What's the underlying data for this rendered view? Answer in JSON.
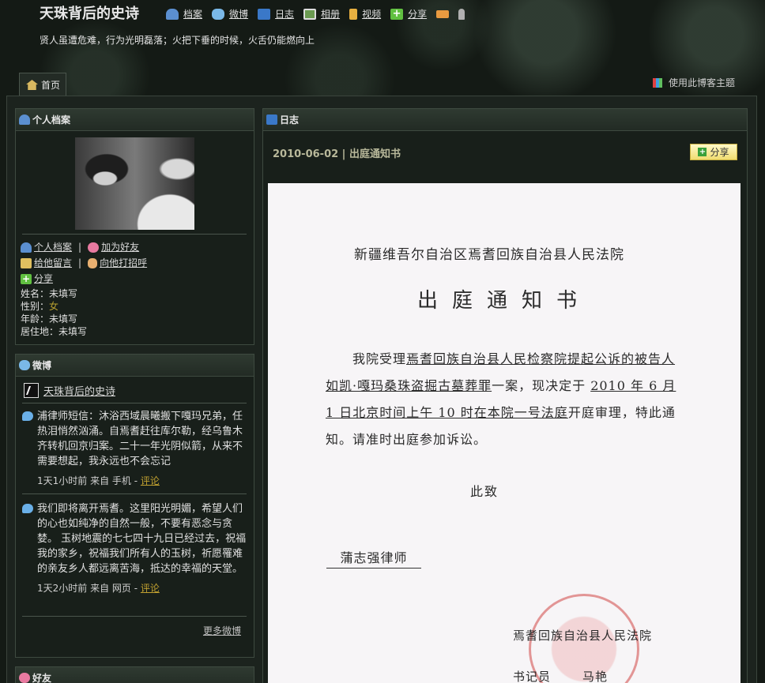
{
  "header": {
    "blog_title": "天珠背后的史诗",
    "subtitle": "贤人虽遭危难，行为光明磊落；火把下垂的时候，火舌仍能燃向上",
    "nav": [
      {
        "label": "档案",
        "icon": "user-icon",
        "color": "#5b8fd0"
      },
      {
        "label": "微博",
        "icon": "speech-bubbles-icon",
        "color": "#7ab8e8"
      },
      {
        "label": "日志",
        "icon": "book-icon",
        "color": "#3a78c8"
      },
      {
        "label": "相册",
        "icon": "photo-icon",
        "color": "#6a9a50"
      },
      {
        "label": "视频",
        "icon": "film-icon",
        "color": "#e8b040"
      },
      {
        "label": "分享",
        "icon": "plus-icon",
        "color": "#60c040"
      }
    ],
    "extra_icons": [
      "mail-icon",
      "person-icon"
    ],
    "home_tab": "首页",
    "theme_link": "使用此博客主题"
  },
  "profile": {
    "title": "个人档案",
    "links": {
      "profile": "个人档案",
      "add_friend": "加为好友",
      "message": "给他留言",
      "greet": "向他打招呼",
      "share": "分享"
    },
    "info": {
      "name_label": "姓名：",
      "name": "未填写",
      "gender_label": "性别：",
      "gender": "女",
      "age_label": "年龄：",
      "age": "未填写",
      "location_label": "居住地：",
      "location": "未填写"
    }
  },
  "weibo": {
    "title": "微博",
    "user": "天珠背后的史诗",
    "posts": [
      {
        "text": "浦律师短信：沐浴西域晨曦搬下嘎玛兄弟，任热泪悄然汹涌。自焉耆赶往库尔勒，经乌鲁木齐转机回京归案。二十一年光阴似箭，从来不需要想起，我永远也不会忘记",
        "time": "1天1小时前 来自 手机",
        "comment": "评论"
      },
      {
        "text": "我们即将离开焉耆。这里阳光明媚，希望人们的心也如纯净的自然一般，不要有恶念与贪婪。 玉树地震的七七四十九日已经过去，祝福我的家乡，祝福我们所有人的玉树，祈愿罹难的亲友乡人都远离苦海，抵达的幸福的天堂。",
        "time": "1天2小时前 来自 网页",
        "comment": "评论"
      }
    ],
    "more": "更多微博"
  },
  "friends": {
    "title": "好友"
  },
  "journal": {
    "title": "日志",
    "entry_title": "2010-06-02 | 出庭通知书",
    "share": "分享",
    "document": {
      "court": "新疆维吾尔自治区焉耆回族自治县人民法院",
      "heading": "出庭通知书",
      "body_1": "我院受理",
      "body_u1": "焉耆回族自治县人民检察院提起公诉的被告人如凯·嘎玛桑珠盗掘古墓葬罪",
      "body_2": "一案，现决定于 ",
      "body_u2": "2010 年 6 月 1 日北京时间上午 10 时在本院一号法庭",
      "body_3": "开庭审理，特此通知。请准时出庭参加诉讼。",
      "cizhi": "此致",
      "lawyer": "蒲志强律师",
      "sign_court": "焉耆回族自治县人民法院",
      "clerk_label": "书记员",
      "clerk_name": "马艳"
    }
  }
}
